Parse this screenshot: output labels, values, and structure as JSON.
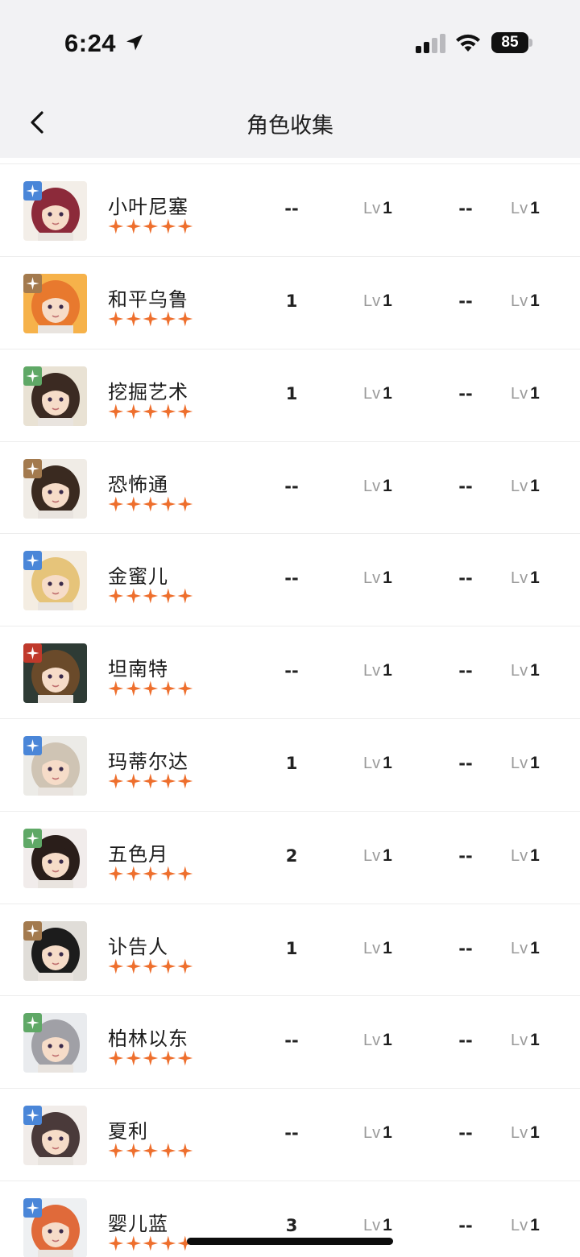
{
  "status_bar": {
    "time": "6:24",
    "battery": "85"
  },
  "header": {
    "title": "角色收集",
    "back_icon": "chevron-left-icon"
  },
  "colors": {
    "star": "#ee6f2d",
    "spectro": "#4a86d8",
    "fusion": "#a37a4e",
    "aero": "#5fa866",
    "havoc": "#c0392b"
  },
  "characters": [
    {
      "name": "小叶尼塞",
      "element": "spectro",
      "stars": 5,
      "col1": "--",
      "lv1_prefix": "Lv",
      "lv1": "1",
      "col3": "--",
      "lv2_prefix": "Lv",
      "lv2": "1"
    },
    {
      "name": "和平乌鲁",
      "element": "fusion",
      "stars": 5,
      "col1": "1",
      "lv1_prefix": "Lv",
      "lv1": "1",
      "col3": "--",
      "lv2_prefix": "Lv",
      "lv2": "1"
    },
    {
      "name": "挖掘艺术",
      "element": "aero",
      "stars": 5,
      "col1": "1",
      "lv1_prefix": "Lv",
      "lv1": "1",
      "col3": "--",
      "lv2_prefix": "Lv",
      "lv2": "1"
    },
    {
      "name": "恐怖通",
      "element": "fusion",
      "stars": 5,
      "col1": "--",
      "lv1_prefix": "Lv",
      "lv1": "1",
      "col3": "--",
      "lv2_prefix": "Lv",
      "lv2": "1"
    },
    {
      "name": "金蜜儿",
      "element": "spectro",
      "stars": 5,
      "col1": "--",
      "lv1_prefix": "Lv",
      "lv1": "1",
      "col3": "--",
      "lv2_prefix": "Lv",
      "lv2": "1"
    },
    {
      "name": "坦南特",
      "element": "havoc",
      "stars": 5,
      "col1": "--",
      "lv1_prefix": "Lv",
      "lv1": "1",
      "col3": "--",
      "lv2_prefix": "Lv",
      "lv2": "1"
    },
    {
      "name": "玛蒂尔达",
      "element": "spectro",
      "stars": 5,
      "col1": "1",
      "lv1_prefix": "Lv",
      "lv1": "1",
      "col3": "--",
      "lv2_prefix": "Lv",
      "lv2": "1"
    },
    {
      "name": "五色月",
      "element": "aero",
      "stars": 5,
      "col1": "2",
      "lv1_prefix": "Lv",
      "lv1": "1",
      "col3": "--",
      "lv2_prefix": "Lv",
      "lv2": "1"
    },
    {
      "name": "讣告人",
      "element": "fusion",
      "stars": 5,
      "col1": "1",
      "lv1_prefix": "Lv",
      "lv1": "1",
      "col3": "--",
      "lv2_prefix": "Lv",
      "lv2": "1"
    },
    {
      "name": "柏林以东",
      "element": "aero",
      "stars": 5,
      "col1": "--",
      "lv1_prefix": "Lv",
      "lv1": "1",
      "col3": "--",
      "lv2_prefix": "Lv",
      "lv2": "1"
    },
    {
      "name": "夏利",
      "element": "spectro",
      "stars": 5,
      "col1": "--",
      "lv1_prefix": "Lv",
      "lv1": "1",
      "col3": "--",
      "lv2_prefix": "Lv",
      "lv2": "1"
    },
    {
      "name": "婴儿蓝",
      "element": "spectro",
      "stars": 5,
      "col1": "3",
      "lv1_prefix": "Lv",
      "lv1": "1",
      "col3": "--",
      "lv2_prefix": "Lv",
      "lv2": "1"
    }
  ]
}
